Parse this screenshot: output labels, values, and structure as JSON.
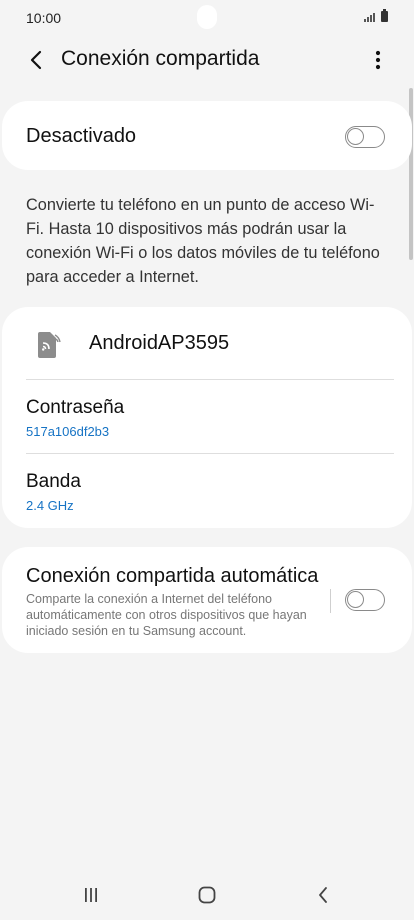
{
  "status_bar": {
    "time": "10:00"
  },
  "header": {
    "title": "Conexión compartida"
  },
  "toggle": {
    "label": "Desactivado",
    "state": "off"
  },
  "description": "Convierte tu teléfono en un punto de acceso Wi-Fi. Hasta 10 dispositivos más podrán usar la conexión Wi-Fi o los datos móviles de tu teléfono para acceder a Internet.",
  "network": {
    "name": "AndroidAP3595",
    "password_label": "Contraseña",
    "password_value": "517a106df2b3",
    "band_label": "Banda",
    "band_value": "2.4 GHz"
  },
  "auto_hotspot": {
    "title": "Conexión compartida automática",
    "description": "Comparte la conexión a Internet del teléfono automáticamente con otros dispositivos que hayan iniciado sesión en tu Samsung account.",
    "state": "off"
  },
  "colors": {
    "accent": "#1673c4",
    "background": "#f4f4f4",
    "card": "#ffffff"
  },
  "icons": [
    "back-arrow",
    "more-vertical",
    "hotspot",
    "recents",
    "home",
    "back"
  ]
}
